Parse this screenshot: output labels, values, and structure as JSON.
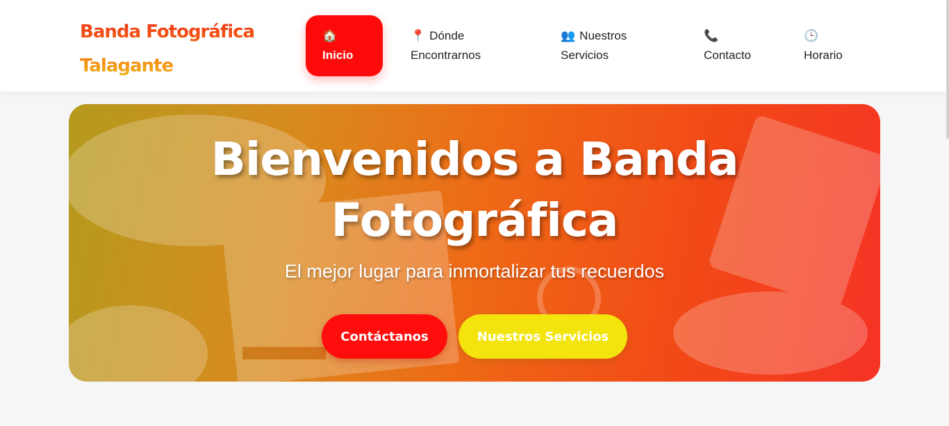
{
  "brand": {
    "line1": "Banda Fotográfica",
    "line2": "Talagante"
  },
  "nav": {
    "items": [
      {
        "icon": "🏠",
        "icon_name": "house-icon",
        "line1": "",
        "line2": "Inicio",
        "active": true
      },
      {
        "icon": "📍",
        "icon_name": "pin-icon",
        "line1": "Dónde",
        "line2": "Encontrarnos",
        "active": false
      },
      {
        "icon": "👥",
        "icon_name": "people-icon",
        "line1": "Nuestros",
        "line2": "Servicios",
        "active": false
      },
      {
        "icon": "📞",
        "icon_name": "phone-icon",
        "line1": "",
        "line2": "Contacto",
        "active": false
      },
      {
        "icon": "🕒",
        "icon_name": "clock-icon",
        "line1": "",
        "line2": "Horario",
        "active": false
      }
    ]
  },
  "hero": {
    "title_line1": "Bienvenidos a Banda",
    "title_line2": "Fotográfica",
    "subtitle": "El mejor lugar para inmortalizar tus recuerdos",
    "buttons": {
      "contact": "Contáctanos",
      "services": "Nuestros Servicios"
    }
  },
  "colors": {
    "accent_red": "#ff0a0a",
    "accent_yellow": "#f2e40c",
    "brand_orange": "#f26a10"
  }
}
